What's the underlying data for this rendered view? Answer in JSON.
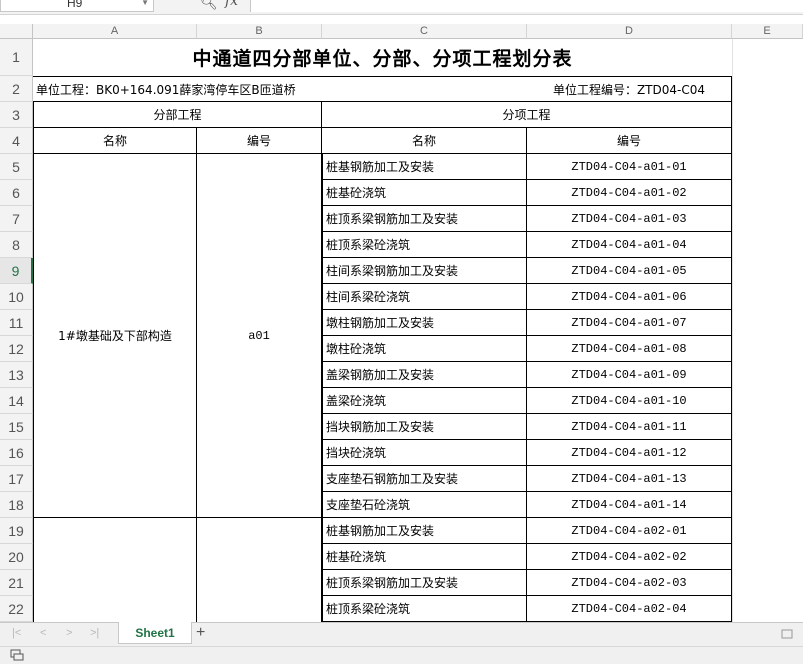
{
  "formula_bar": {
    "cell_ref": "H9",
    "fx_label": "fx",
    "formula": ""
  },
  "columns": [
    "A",
    "B",
    "C",
    "D",
    "E"
  ],
  "rows": [
    "1",
    "2",
    "3",
    "4",
    "5",
    "6",
    "7",
    "8",
    "9",
    "10",
    "11",
    "12",
    "13",
    "14",
    "15",
    "16",
    "17",
    "18",
    "19",
    "20",
    "21",
    "22"
  ],
  "selected_row": "9",
  "sheet": {
    "title": "中通道四分部单位、分部、分项工程划分表",
    "unit_project": "单位工程：BK0+164.091薛家湾停车区B匝道桥",
    "unit_code": "单位工程编号：ZTD04-C04",
    "header_division": "分部工程",
    "header_subitem": "分项工程",
    "col_name": "名称",
    "col_code": "编号",
    "col_sub_name": "名称",
    "col_sub_code": "编号",
    "division_1_name": "1#墩基础及下部构造",
    "division_1_code": "a01",
    "items": [
      {
        "name": "桩基钢筋加工及安装",
        "code": "ZTD04-C04-a01-01"
      },
      {
        "name": "桩基砼浇筑",
        "code": "ZTD04-C04-a01-02"
      },
      {
        "name": "桩顶系梁钢筋加工及安装",
        "code": "ZTD04-C04-a01-03"
      },
      {
        "name": "桩顶系梁砼浇筑",
        "code": "ZTD04-C04-a01-04"
      },
      {
        "name": "柱间系梁钢筋加工及安装",
        "code": "ZTD04-C04-a01-05"
      },
      {
        "name": "柱间系梁砼浇筑",
        "code": "ZTD04-C04-a01-06"
      },
      {
        "name": "墩柱钢筋加工及安装",
        "code": "ZTD04-C04-a01-07"
      },
      {
        "name": "墩柱砼浇筑",
        "code": "ZTD04-C04-a01-08"
      },
      {
        "name": "盖梁钢筋加工及安装",
        "code": "ZTD04-C04-a01-09"
      },
      {
        "name": "盖梁砼浇筑",
        "code": "ZTD04-C04-a01-10"
      },
      {
        "name": "挡块钢筋加工及安装",
        "code": "ZTD04-C04-a01-11"
      },
      {
        "name": "挡块砼浇筑",
        "code": "ZTD04-C04-a01-12"
      },
      {
        "name": "支座垫石钢筋加工及安装",
        "code": "ZTD04-C04-a01-13"
      },
      {
        "name": "支座垫石砼浇筑",
        "code": "ZTD04-C04-a01-14"
      },
      {
        "name": "桩基钢筋加工及安装",
        "code": "ZTD04-C04-a02-01"
      },
      {
        "name": "桩基砼浇筑",
        "code": "ZTD04-C04-a02-02"
      },
      {
        "name": "桩顶系梁钢筋加工及安装",
        "code": "ZTD04-C04-a02-03"
      },
      {
        "name": "桩顶系梁砼浇筑",
        "code": "ZTD04-C04-a02-04"
      }
    ]
  },
  "tabs": {
    "active": "Sheet1",
    "add_label": "+"
  },
  "nav_buttons": [
    "|<",
    "<",
    ">",
    ">|"
  ],
  "colors": {
    "accent": "#217346",
    "gridline": "#e1e1e1",
    "border": "#000000"
  }
}
